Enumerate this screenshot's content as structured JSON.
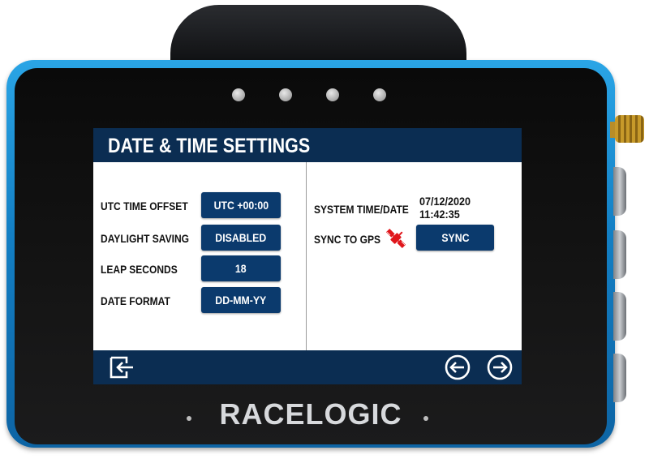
{
  "device": {
    "brand": "RACELOGIC"
  },
  "screen": {
    "title": "DATE & TIME  SETTINGS",
    "left_panel": {
      "utc_offset": {
        "label": "UTC TIME OFFSET",
        "value": "UTC +00:00"
      },
      "daylight_saving": {
        "label": "DAYLIGHT SAVING",
        "value": "DISABLED"
      },
      "leap_seconds": {
        "label": "LEAP SECONDS",
        "value": "18"
      },
      "date_format": {
        "label": "DATE FORMAT",
        "value": "DD-MM-YY"
      }
    },
    "right_panel": {
      "system_time": {
        "label": "SYSTEM TIME/DATE",
        "date": "07/12/2020",
        "time": "11:42:35"
      },
      "sync_gps": {
        "label": "SYNC TO GPS",
        "button": "SYNC",
        "status_icon": "satellite-error-icon"
      }
    },
    "footer": {
      "icons": [
        "exit-icon",
        "arrow-left-icon",
        "arrow-right-icon"
      ]
    }
  },
  "colors": {
    "bar": "#0b2d52",
    "button": "#0b3a6d",
    "device_blue": "#1a8fd6",
    "satellite_red": "#e0161b"
  }
}
